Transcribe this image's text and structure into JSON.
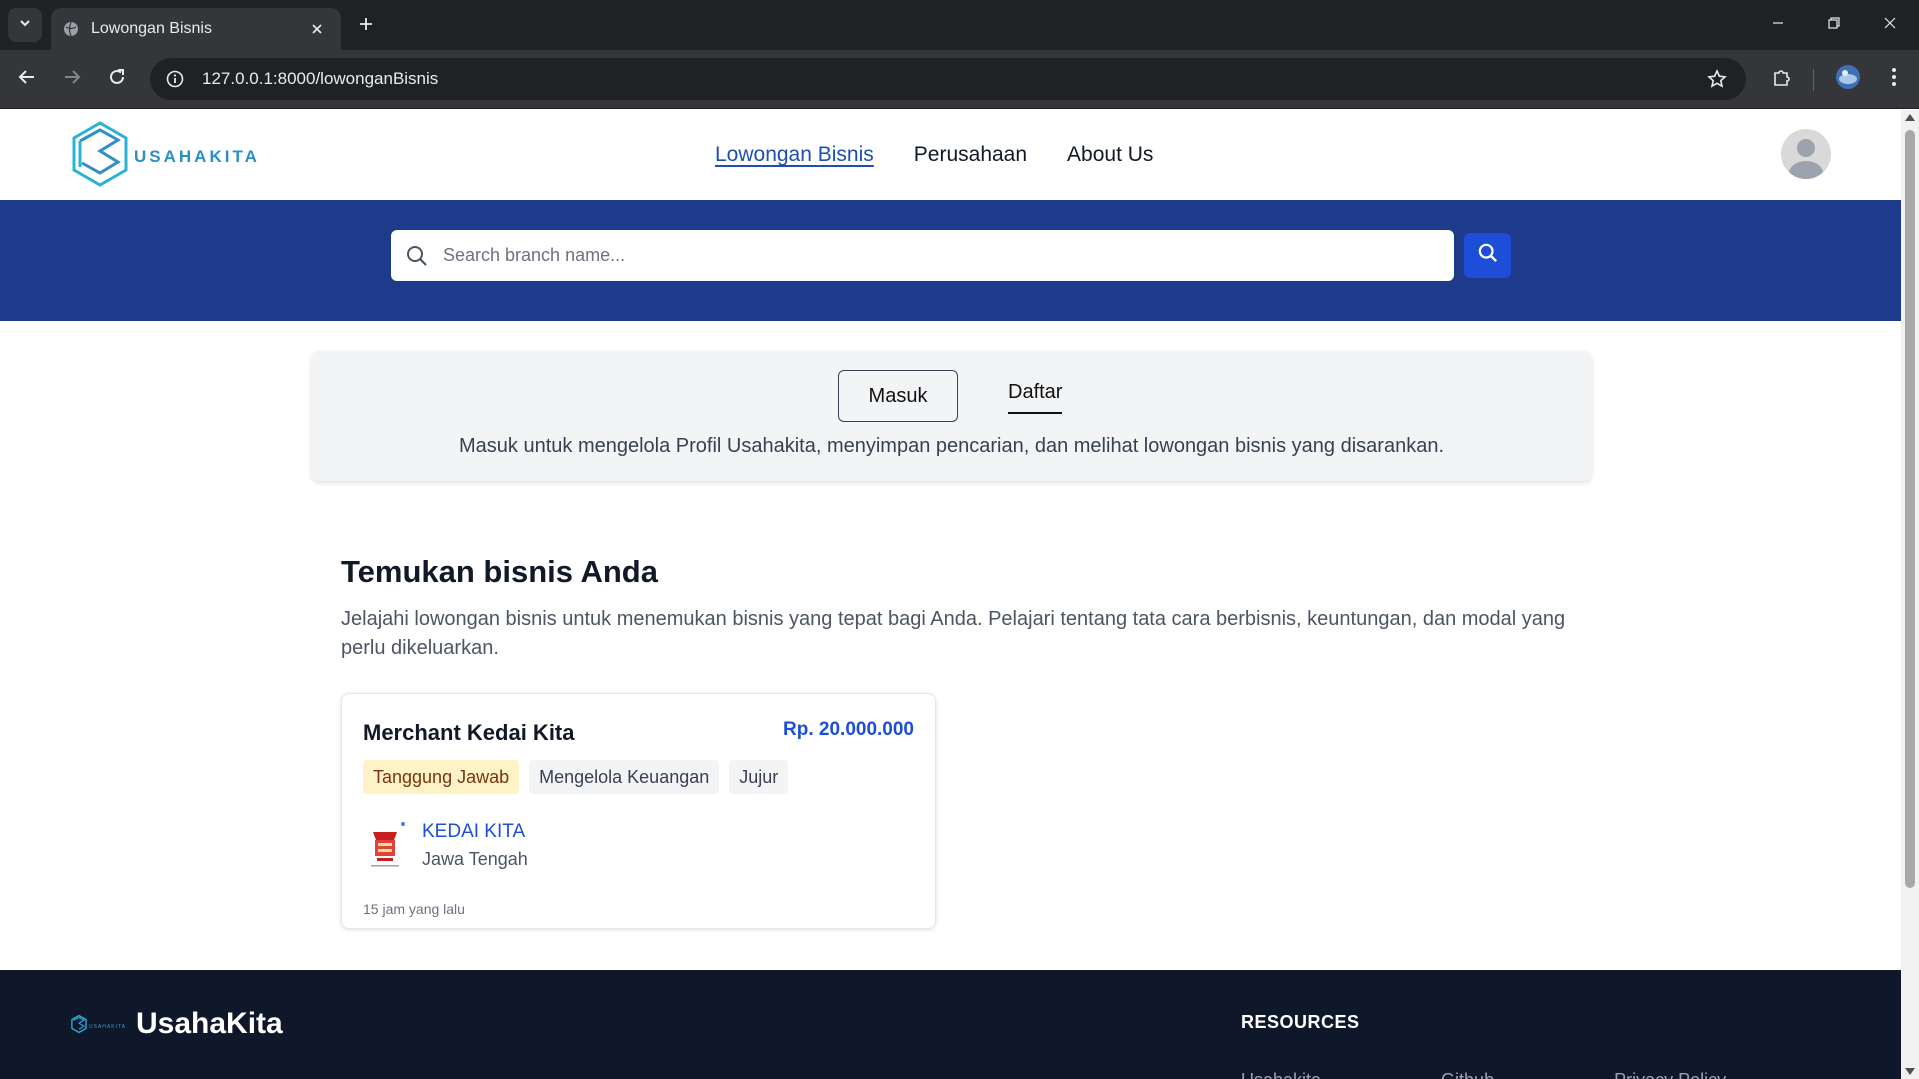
{
  "browser": {
    "tab_title": "Lowongan Bisnis",
    "url": "127.0.0.1:8000/lowonganBisnis"
  },
  "header": {
    "logo_text": "USAHAKITA",
    "nav": [
      {
        "label": "Lowongan Bisnis",
        "active": true
      },
      {
        "label": "Perusahaan",
        "active": false
      },
      {
        "label": "About Us",
        "active": false
      }
    ]
  },
  "search": {
    "placeholder": "Search branch name..."
  },
  "auth": {
    "login_label": "Masuk",
    "register_label": "Daftar",
    "description": "Masuk untuk mengelola Profil Usahakita, menyimpan pencarian, dan melihat lowongan bisnis yang disarankan."
  },
  "content": {
    "title": "Temukan bisnis Anda",
    "description": "Jelajahi lowongan bisnis untuk menemukan bisnis yang tepat bagi Anda. Pelajari tentang tata cara berbisnis, keuntungan, dan modal yang perlu dikeluarkan."
  },
  "listings": [
    {
      "title": "Merchant Kedai Kita",
      "price": "Rp. 20.000.000",
      "tags": [
        "Tanggung Jawab",
        "Mengelola Keuangan",
        "Jujur"
      ],
      "company": "KEDAI KITA",
      "location": "Jawa Tengah",
      "posted": "15 jam yang lalu"
    }
  ],
  "footer": {
    "brand": "UsahaKita",
    "resources_heading": "RESOURCES",
    "links": [
      "Usahakita",
      "Github",
      "Privacy Policy"
    ]
  },
  "colors": {
    "primary_band": "#1e3a8a",
    "accent_blue": "#1d4ed8",
    "footer_bg": "#0f172a"
  },
  "icons": [
    "chevron-down-icon",
    "globe-icon",
    "close-icon",
    "plus-icon",
    "minimize-icon",
    "restore-icon",
    "back-icon",
    "forward-icon",
    "reload-icon",
    "info-icon",
    "star-icon",
    "extensions-icon",
    "profile-icon",
    "search-icon",
    "user-avatar-icon"
  ]
}
